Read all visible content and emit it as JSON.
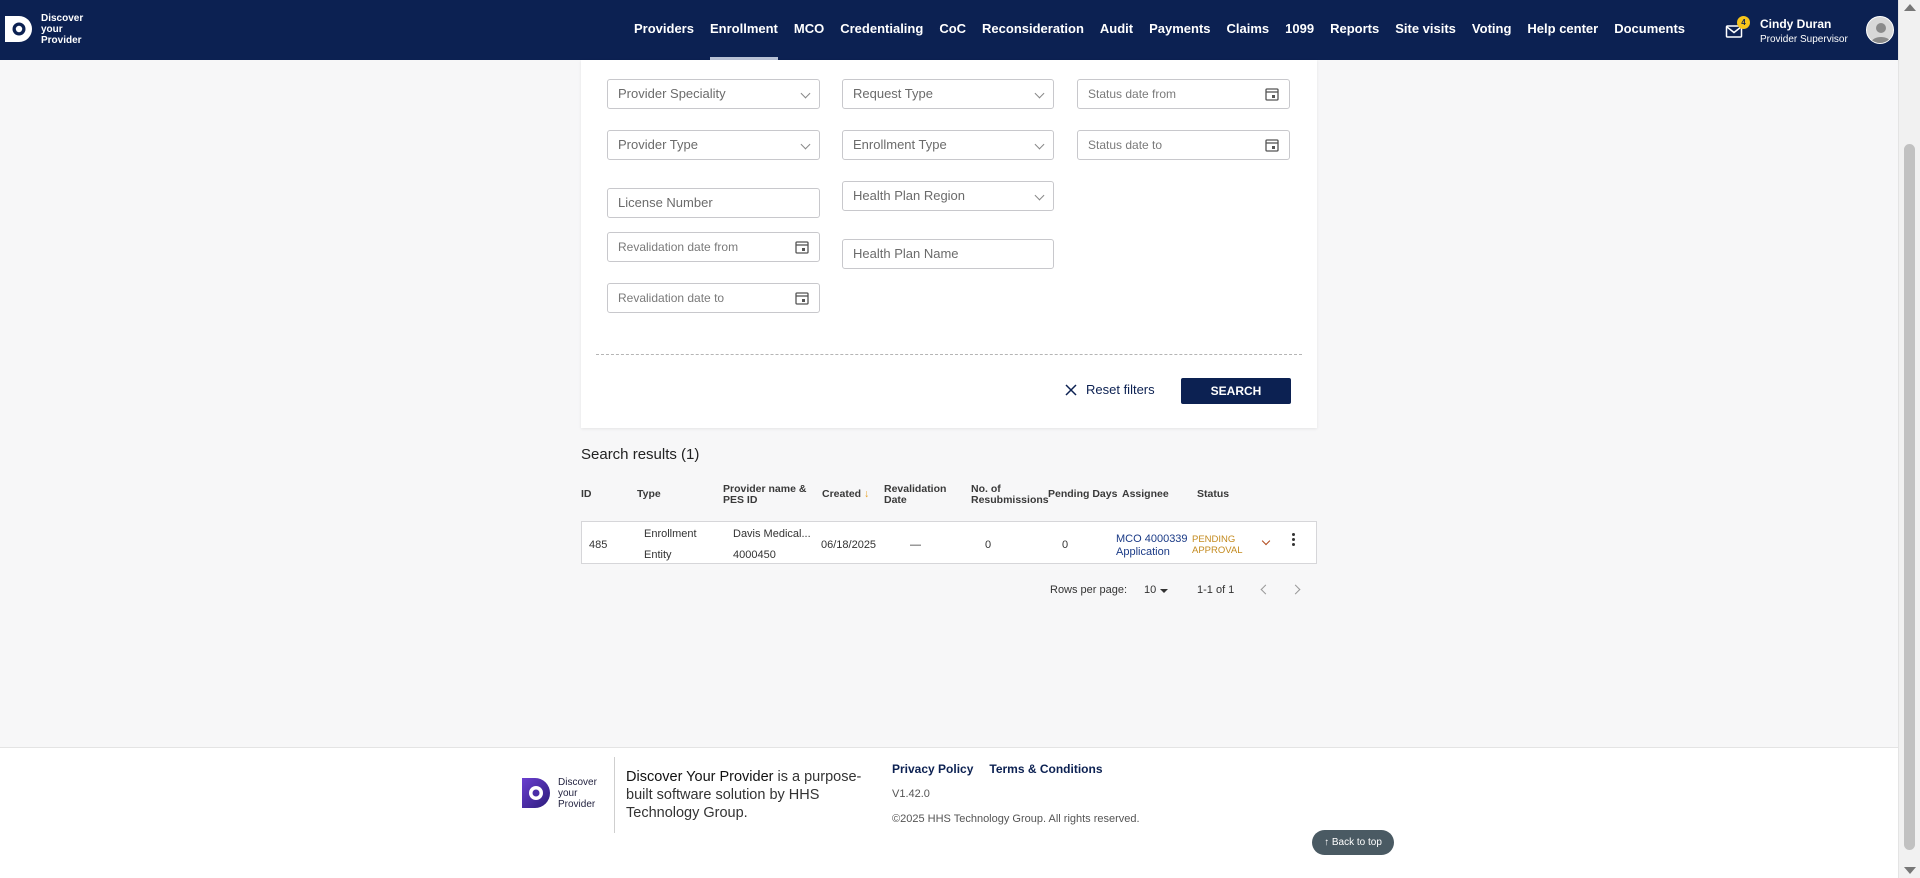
{
  "header": {
    "logo_lines": [
      "Discover",
      "your",
      "Provider"
    ],
    "nav": [
      "Providers",
      "Enrollment",
      "MCO",
      "Credentialing",
      "CoC",
      "Reconsideration",
      "Audit",
      "Payments",
      "Claims",
      "1099",
      "Reports",
      "Site visits",
      "Voting",
      "Help center",
      "Documents"
    ],
    "active_nav": "Enrollment",
    "notification_count": "4",
    "user_name": "Cindy Duran",
    "user_role": "Provider Supervisor"
  },
  "filters": {
    "provider_speciality": "Provider Speciality",
    "request_type": "Request Type",
    "status_date_from": "Status date from",
    "provider_type": "Provider Type",
    "enrollment_type": "Enrollment Type",
    "status_date_to": "Status date to",
    "license_number": "License Number",
    "health_plan_region": "Health Plan Region",
    "revalidation_date_from": "Revalidation date from",
    "health_plan_name": "Health Plan Name",
    "revalidation_date_to": "Revalidation date to",
    "reset_label": "Reset filters",
    "search_label": "SEARCH"
  },
  "results": {
    "title": "Search results (1)",
    "columns": {
      "id": "ID",
      "type": "Type",
      "provider_name": "Provider name & PES ID",
      "created": "Created",
      "revalidation_date": "Revalidation Date",
      "resubmissions": "No. of Resubmissions",
      "pending_days": "Pending Days",
      "assignee": "Assignee",
      "status": "Status"
    },
    "rows": [
      {
        "id": "485",
        "type_line1": "Enrollment",
        "type_line2": "Entity",
        "provider_name": "Davis Medical...",
        "pes_id": "4000450",
        "created": "06/18/2025",
        "revalidation_date": "—",
        "resubmissions": "0",
        "pending_days": "0",
        "assignee_line1": "MCO 4000339",
        "assignee_line2": "Application",
        "status_line1": "PENDING",
        "status_line2": "APPROVAL"
      }
    ],
    "rows_per_page_label": "Rows per page:",
    "rows_per_page": "10",
    "range": "1-1 of 1"
  },
  "footer": {
    "logo_lines": [
      "Discover",
      "your",
      "Provider"
    ],
    "tagline_brand": "Discover Your Provider",
    "tagline_rest": " is a purpose-built software solution by HHS Technology Group.",
    "privacy": "Privacy Policy",
    "terms": "Terms & Conditions",
    "version": "V1.42.0",
    "copyright": "©2025 HHS Technology Group. All rights reserved.",
    "back_to_top": "↑ Back to top"
  },
  "colors": {
    "header_bg": "#0c2152",
    "primary": "#0c2152",
    "status_pending": "#c38a1e",
    "badge": "#f7c51b"
  }
}
